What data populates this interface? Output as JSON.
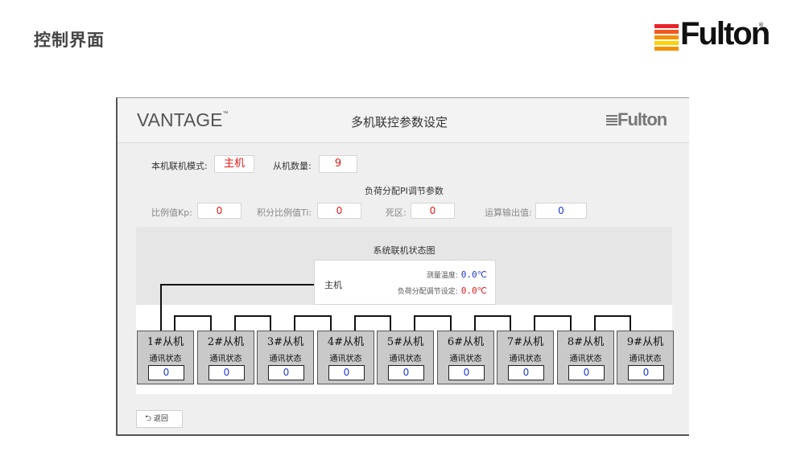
{
  "page": {
    "title": "控制界面"
  },
  "brand": {
    "name": "Fulton",
    "reg": "®"
  },
  "screen": {
    "product": "VANTAGE",
    "product_tm": "™",
    "title": "多机联控参数设定",
    "logo_text": "Fulton",
    "mode": {
      "label": "本机联机模式:",
      "value": "主机"
    },
    "slave_count": {
      "label": "从机数量:",
      "value": "9"
    },
    "pi_section_title": "负荷分配PI调节参数",
    "pi": {
      "kp": {
        "label": "比例值Kp:",
        "value": "0"
      },
      "ti": {
        "label": "积分比例值Ti:",
        "value": "0"
      },
      "deadband": {
        "label": "死区:",
        "value": "0"
      },
      "output": {
        "label": "运算输出值:",
        "value": "0"
      }
    },
    "diagram": {
      "title": "系统联机状态图",
      "master": {
        "name": "主机",
        "measured_temp_label": "测量温度:",
        "measured_temp_value": "0.0℃",
        "setpoint_label": "负荷分配调节设定:",
        "setpoint_value": "0.0℃"
      },
      "status_label": "通讯状态",
      "slaves": [
        {
          "name": "1#从机",
          "status": "0"
        },
        {
          "name": "2#从机",
          "status": "0"
        },
        {
          "name": "3#从机",
          "status": "0"
        },
        {
          "name": "4#从机",
          "status": "0"
        },
        {
          "name": "5#从机",
          "status": "0"
        },
        {
          "name": "6#从机",
          "status": "0"
        },
        {
          "name": "7#从机",
          "status": "0"
        },
        {
          "name": "8#从机",
          "status": "0"
        },
        {
          "name": "9#从机",
          "status": "0"
        }
      ]
    },
    "back_button": {
      "icon": "return-arrow-icon",
      "label": "返回"
    }
  },
  "colors": {
    "value_red": "#e01818",
    "value_blue": "#1e3ac8",
    "logo_red": "#e8232a",
    "logo_orange": "#f39200",
    "logo_yellow": "#ffd200"
  }
}
